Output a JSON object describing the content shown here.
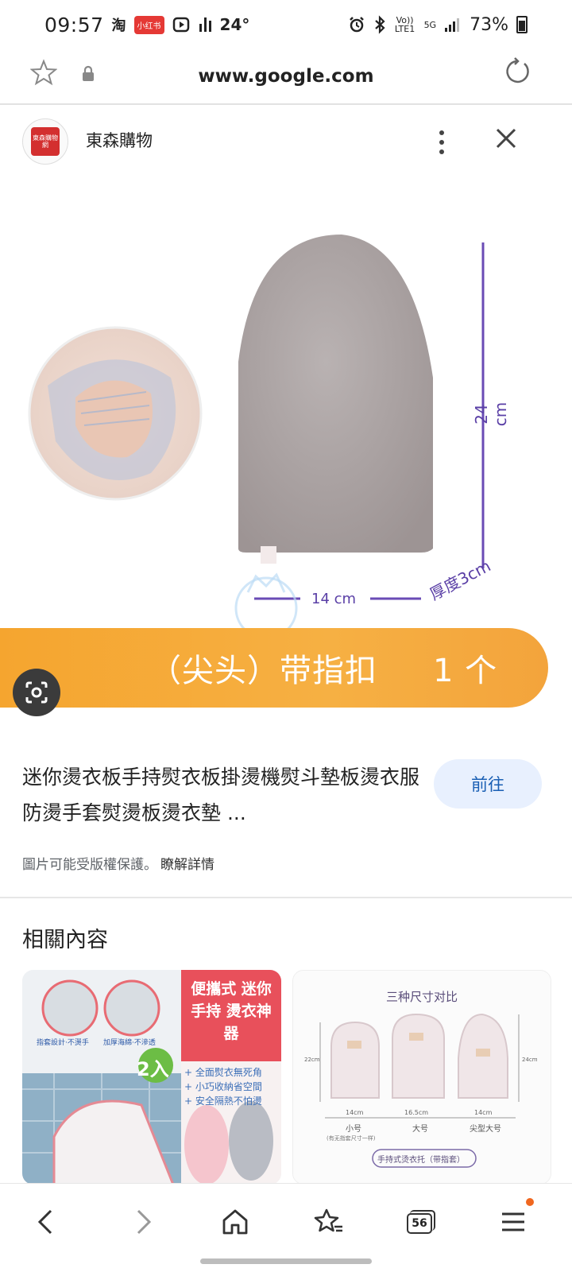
{
  "status_bar": {
    "time": "09:57",
    "app_taobao": "淘",
    "app_redbook": "小红书",
    "temperature": "24°",
    "volte": "Vo)) LTE1",
    "network": "5G",
    "battery": "73%"
  },
  "url_bar": {
    "url": "www.google.com"
  },
  "source": {
    "name": "東森購物",
    "logo_text": "東森購物網"
  },
  "image": {
    "dimension_height": "24 cm",
    "dimension_width": "14 cm",
    "dimension_thickness": "厚度3cm",
    "banner_text_1": "（尖头）带指扣",
    "banner_text_2": "1 个"
  },
  "result": {
    "title": "迷你燙衣板手持熨衣板掛燙機熨斗墊板燙衣服防燙手套熨燙板燙衣墊 ...",
    "go_label": "前往",
    "copyright_note": "圖片可能受版權保護。",
    "learn_more": "瞭解詳情"
  },
  "related": {
    "heading": "相關內容",
    "card1": {
      "headline": "便攜式 迷你手持 燙衣神器",
      "badge": "2入",
      "tag1": "指套設計·不燙手",
      "tag2": "加厚海綿·不滲透",
      "bullet1": "+ 全面熨衣無死角",
      "bullet2": "+ 小巧收納省空間",
      "bullet3": "+ 安全隔熱不怕燙"
    },
    "card2": {
      "title": "三种尺寸对比",
      "size_small": "小号",
      "size_small_note": "(有无指套尺寸一样)",
      "size_large": "大号",
      "size_pointed": "尖型大号",
      "w_small": "14cm",
      "w_large": "16.5cm",
      "w_pointed": "14cm",
      "h_left": "22cm",
      "h_right": "24cm",
      "footer": "手持式烫衣托（带指套）"
    }
  },
  "bottom_nav": {
    "tabs_count": "56"
  },
  "colors": {
    "banner": "#f5a52f",
    "go_button_bg": "#e8f0fe",
    "go_button_text": "#1a5fb4",
    "dimension_line": "#6a4bb5",
    "notif_dot": "#f0671f"
  }
}
